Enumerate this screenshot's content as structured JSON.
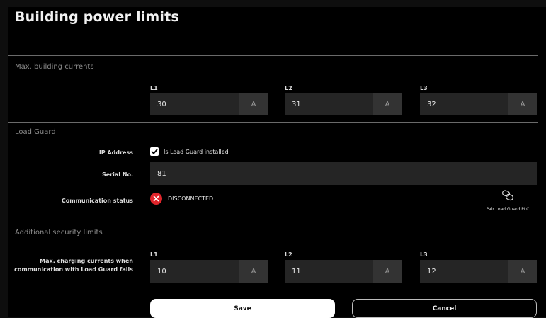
{
  "page": {
    "title": "Building power limits"
  },
  "max_building": {
    "label": "Max. building currents",
    "phases": [
      {
        "label": "L1",
        "value": "30",
        "unit": "A"
      },
      {
        "label": "L2",
        "value": "31",
        "unit": "A"
      },
      {
        "label": "L3",
        "value": "32",
        "unit": "A"
      }
    ]
  },
  "load_guard": {
    "label": "Load Guard",
    "ip_label": "IP Address",
    "installed_label": "Is Load Guard installed",
    "installed": true,
    "serial_label": "Serial No.",
    "serial_value": "81",
    "comm_label": "Communication status",
    "comm_status": "DISCONNECTED",
    "pair_label": "Pair Load Guard PLC"
  },
  "security": {
    "label": "Additional security limits",
    "row_label_line1": "Max. charging currents when",
    "row_label_line2": "communication with Load Guard fails",
    "phases": [
      {
        "label": "L1",
        "value": "10",
        "unit": "A"
      },
      {
        "label": "L2",
        "value": "11",
        "unit": "A"
      },
      {
        "label": "L3",
        "value": "12",
        "unit": "A"
      }
    ]
  },
  "actions": {
    "save": "Save",
    "cancel": "Cancel"
  },
  "colors": {
    "error": "#e0252b",
    "background": "#000000",
    "field": "#252525"
  }
}
